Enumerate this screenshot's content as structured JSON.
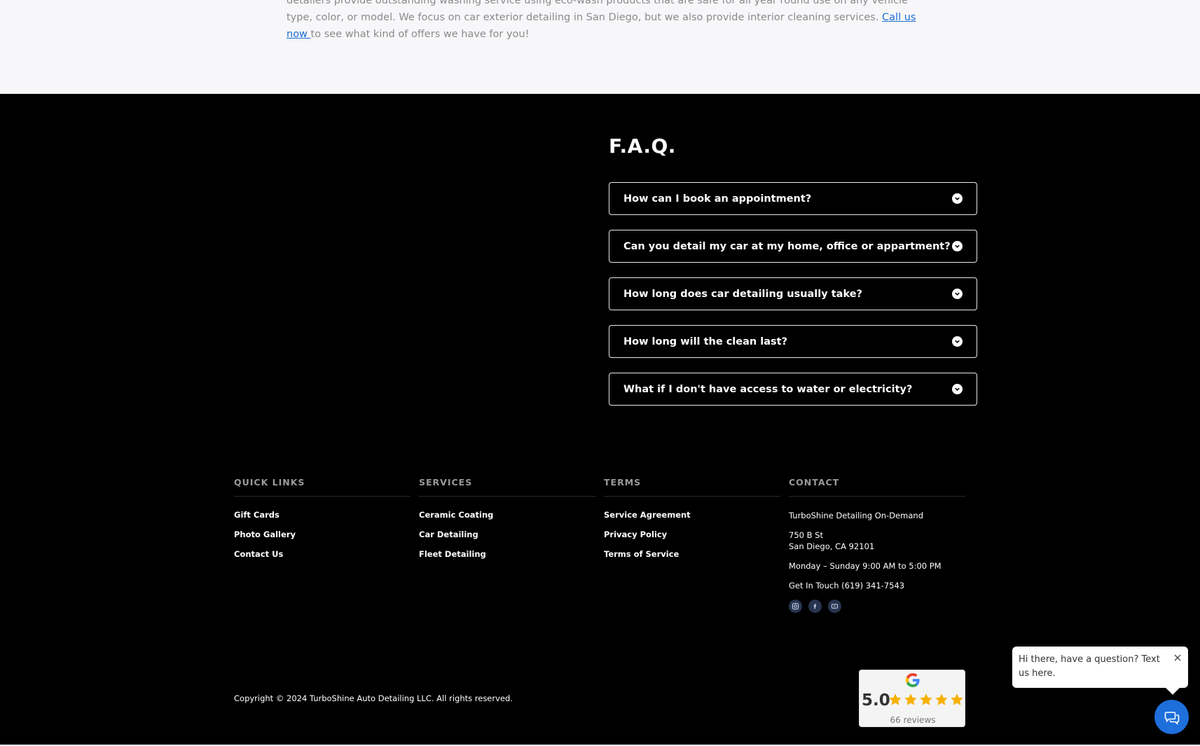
{
  "intro": {
    "line1": "detailers provide outstanding washing service using eco-wash products that are safe for all year round use on any vehicle type, color, or model. We focus on car exterior detailing in San Diego, but we also provide interior cleaning services.",
    "link": "Call us now ",
    "line2": "to see what kind of offers we have for you!"
  },
  "faq": {
    "title": "F.A.Q.",
    "items": [
      "How can I book an appointment?",
      "Can you detail my car at my home, office or appartment?",
      "How long does car detailing usually take?",
      "How long will the clean last?",
      "What if I don't have access to water or electricity?"
    ]
  },
  "footer": {
    "quick_links": {
      "heading": "QUICK LINKS",
      "items": [
        "Gift Cards",
        "Photo Gallery",
        "Contact Us"
      ]
    },
    "services": {
      "heading": "SERVICES",
      "items": [
        "Ceramic Coating",
        "Car Detailing",
        "Fleet Detailing"
      ]
    },
    "terms": {
      "heading": "TERMS",
      "items": [
        "Service Agreement",
        "Privacy Policy",
        "Terms of Service"
      ]
    },
    "contact": {
      "heading": "CONTACT",
      "company": "TurboShine Detailing On-Demand",
      "street": "750 B St",
      "city": "San Diego, CA 92101",
      "hours": "Monday – Sunday 9:00 AM to 5:00 PM",
      "phone": "Get In Touch (619) 341-7543",
      "socials": [
        "instagram-icon",
        "facebook-icon",
        "youtube-icon"
      ]
    },
    "copyright": "Copyright © 2024 TurboShine Auto Detailing LLC. All rights reserved."
  },
  "google_badge": {
    "score": "5.0",
    "rating": 5,
    "reviews": "66 reviews"
  },
  "chat": {
    "message": "Hi there, have a question? Text us here."
  },
  "colors": {
    "accent": "#1e6fdc",
    "star": "#f6b100",
    "link": "#1a6fd6"
  }
}
